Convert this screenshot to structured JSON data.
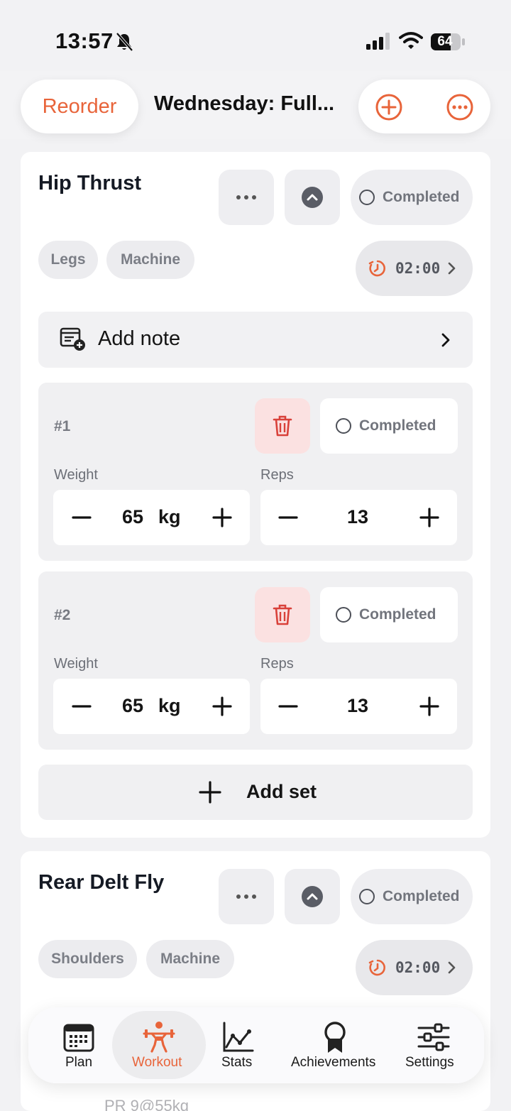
{
  "status_bar": {
    "time": "13:57",
    "battery": "64"
  },
  "header": {
    "reorder_label": "Reorder",
    "title": "Wednesday: Full..."
  },
  "exercises": [
    {
      "name": "Hip Thrust",
      "completed_label": "Completed",
      "tags": [
        "Legs",
        "Machine"
      ],
      "rest_timer": "02:00",
      "note_label": "Add note",
      "sets": [
        {
          "number": "#1",
          "completed_label": "Completed",
          "weight_label": "Weight",
          "weight": "65",
          "unit": "kg",
          "reps_label": "Reps",
          "reps": "13"
        },
        {
          "number": "#2",
          "completed_label": "Completed",
          "weight_label": "Weight",
          "weight": "65",
          "unit": "kg",
          "reps_label": "Reps",
          "reps": "13"
        }
      ],
      "add_set_label": "Add set"
    },
    {
      "name": "Rear Delt Fly",
      "completed_label": "Completed",
      "tags": [
        "Shoulders",
        "Machine"
      ],
      "rest_timer": "02:00"
    }
  ],
  "peek": {
    "pr_text": "PR 9@55kg"
  },
  "tabs": [
    {
      "label": "Plan",
      "icon": "calendar-icon",
      "active": false
    },
    {
      "label": "Workout",
      "icon": "weightlifter-icon",
      "active": true
    },
    {
      "label": "Stats",
      "icon": "chart-line-icon",
      "active": false
    },
    {
      "label": "Achievements",
      "icon": "ribbon-icon",
      "active": false
    },
    {
      "label": "Settings",
      "icon": "sliders-icon",
      "active": false
    }
  ],
  "colors": {
    "accent": "#e8643a",
    "danger_bg": "#fbe1e1",
    "danger": "#d9413a",
    "background": "#f2f2f4"
  }
}
